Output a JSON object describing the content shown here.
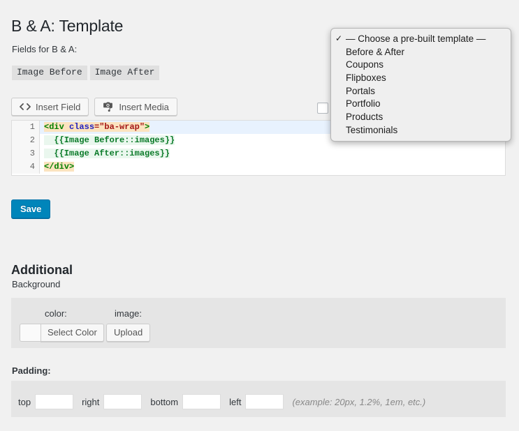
{
  "page": {
    "title": "B & A: Template",
    "fields_label": "Fields for B & A:"
  },
  "fields": [
    {
      "label": "Image Before"
    },
    {
      "label": "Image After"
    }
  ],
  "toolbar": {
    "insert_field_label": "Insert Field",
    "insert_media_label": "Insert Media"
  },
  "editor": {
    "lines": [
      {
        "number": "1"
      },
      {
        "number": "2"
      },
      {
        "number": "3"
      },
      {
        "number": "4"
      }
    ],
    "line1": {
      "tag_open": "<div",
      "attr": "class",
      "value": "=\"ba-wrap\"",
      "tag_close": ">"
    },
    "line2": "  {{Image Before::images}}",
    "line3": "  {{Image After::images}}",
    "line4": "</div>"
  },
  "save": {
    "label": "Save"
  },
  "additional": {
    "heading": "Additional",
    "background_label": "Background",
    "color_label": "color:",
    "image_label": "image:",
    "select_color_label": "Select Color",
    "upload_label": "Upload",
    "padding_label": "Padding:",
    "padding_fields": [
      {
        "label": "top",
        "value": ""
      },
      {
        "label": "right",
        "value": ""
      },
      {
        "label": "bottom",
        "value": ""
      },
      {
        "label": "left",
        "value": ""
      }
    ],
    "padding_hint": "(example: 20px, 1.2%, 1em, etc.)"
  },
  "dropdown": {
    "check_glyph": "✓",
    "items": [
      {
        "label": "— Choose a pre-built template —",
        "selected": true
      },
      {
        "label": "Before & After",
        "selected": false
      },
      {
        "label": "Coupons",
        "selected": false
      },
      {
        "label": "Flipboxes",
        "selected": false
      },
      {
        "label": "Portals",
        "selected": false
      },
      {
        "label": "Portfolio",
        "selected": false
      },
      {
        "label": "Products",
        "selected": false
      },
      {
        "label": "Testimonials",
        "selected": false
      }
    ]
  },
  "colors": {
    "accent": "#0085ba",
    "page_bg": "#f1f1f1",
    "panel_bg": "#e5e5e5",
    "tag_bg": "#e0e0e0"
  }
}
